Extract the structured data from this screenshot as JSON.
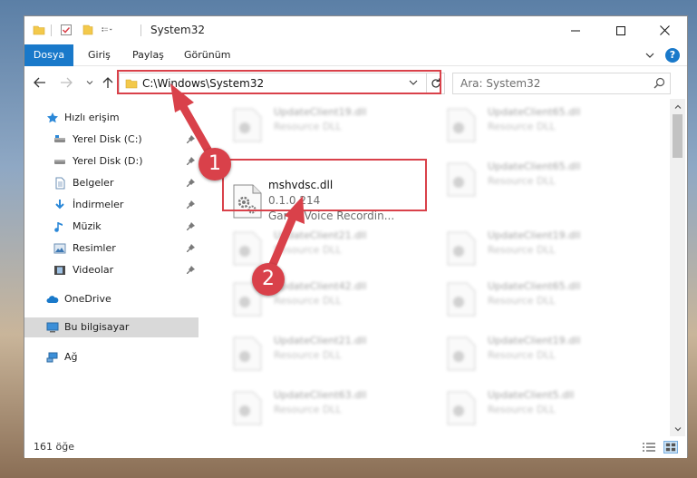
{
  "window": {
    "title": "System32"
  },
  "ribbon": {
    "tabs": [
      "Dosya",
      "Giriş",
      "Paylaş",
      "Görünüm"
    ],
    "help": "?"
  },
  "address": {
    "path": "C:\\Windows\\System32"
  },
  "search": {
    "placeholder": "Ara: System32"
  },
  "sidebar": {
    "items": [
      {
        "label": "Hızlı erişim"
      },
      {
        "label": "Yerel Disk (C:)"
      },
      {
        "label": "Yerel Disk (D:)"
      },
      {
        "label": "Belgeler"
      },
      {
        "label": "İndirmeler"
      },
      {
        "label": "Müzik"
      },
      {
        "label": "Resimler"
      },
      {
        "label": "Videolar"
      },
      {
        "label": "OneDrive"
      },
      {
        "label": "Bu bilgisayar"
      },
      {
        "label": "Ağ"
      }
    ]
  },
  "files": {
    "selected": {
      "name": "mshvdsc.dll",
      "version": "0.1.0.214",
      "description": "Game Voice Recordin..."
    },
    "background": [
      {
        "name": "UpdateClient19.dll",
        "desc": "Resource DLL"
      },
      {
        "name": "UpdateClient65.dll",
        "desc": "Resource DLL"
      },
      {
        "name": "UpdateClient65.dll",
        "desc": "Resource DLL"
      },
      {
        "name": "UpdateClient21.dll",
        "desc": "Resource DLL"
      },
      {
        "name": "UpdateClient19.dll",
        "desc": "Resource DLL"
      },
      {
        "name": "UpdateClient42.dll",
        "desc": "Resource DLL"
      },
      {
        "name": "UpdateClient65.dll",
        "desc": "Resource DLL"
      },
      {
        "name": "UpdateClient21.dll",
        "desc": "Resource DLL"
      },
      {
        "name": "UpdateClient19.dll",
        "desc": "Resource DLL"
      },
      {
        "name": "UpdateClient63.dll",
        "desc": "Resource DLL"
      },
      {
        "name": "UpdateClient5.dll",
        "desc": "Resource DLL"
      }
    ]
  },
  "status": {
    "count": "161 öğe"
  },
  "annotations": {
    "step1": "1",
    "step2": "2"
  },
  "colors": {
    "accent": "#1979ca",
    "annotation": "#d9414a"
  }
}
